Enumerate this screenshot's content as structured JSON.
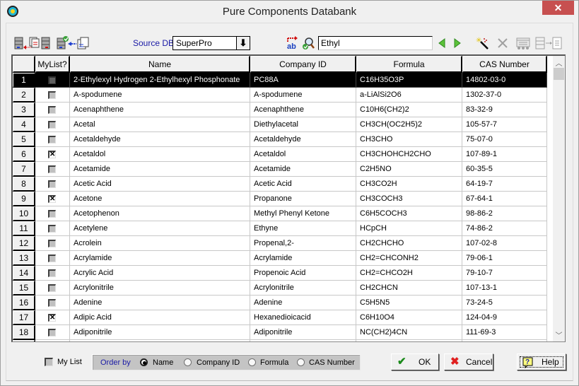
{
  "window": {
    "title": "Pure Components Databank",
    "close_label": "✕"
  },
  "toolbar": {
    "source_db_label": "Source DB",
    "source_db_value": "SuperPro",
    "search_value": "Ethyl",
    "icons": [
      "import-from-db-icon",
      "db-to-db-copy-icon",
      "verify-import-icon",
      "copy-list-icon",
      "find-replace-icon",
      "find-icon",
      "previous-icon",
      "next-icon",
      "new-component-icon",
      "delete-icon",
      "properties-icon",
      "export-icon"
    ]
  },
  "grid": {
    "columns": [
      "",
      "MyList?",
      "Name",
      "Company ID",
      "Formula",
      "CAS Number"
    ],
    "rows": [
      {
        "num": "1",
        "mylist": false,
        "name": "2-Ethylexyl Hydrogen 2-Ethylhexyl Phosphonate",
        "company_id": "PC88A",
        "formula": "C16H35O3P",
        "cas": "14802-03-0",
        "selected": true
      },
      {
        "num": "2",
        "mylist": false,
        "name": "A-spodumene",
        "company_id": "A-spodumene",
        "formula": "a-LiAlSi2O6",
        "cas": "1302-37-0"
      },
      {
        "num": "3",
        "mylist": false,
        "name": "Acenaphthene",
        "company_id": "Acenaphthene",
        "formula": "C10H6(CH2)2",
        "cas": "83-32-9"
      },
      {
        "num": "4",
        "mylist": false,
        "name": "Acetal",
        "company_id": "Diethylacetal",
        "formula": "CH3CH(OC2H5)2",
        "cas": "105-57-7"
      },
      {
        "num": "5",
        "mylist": false,
        "name": "Acetaldehyde",
        "company_id": "Acetaldehyde",
        "formula": "CH3CHO",
        "cas": "75-07-0"
      },
      {
        "num": "6",
        "mylist": true,
        "name": "Acetaldol",
        "company_id": "Acetaldol",
        "formula": "CH3CHOHCH2CHO",
        "cas": "107-89-1"
      },
      {
        "num": "7",
        "mylist": false,
        "name": "Acetamide",
        "company_id": "Acetamide",
        "formula": "C2H5NO",
        "cas": "60-35-5"
      },
      {
        "num": "8",
        "mylist": false,
        "name": "Acetic Acid",
        "company_id": "Acetic Acid",
        "formula": "CH3CO2H",
        "cas": "64-19-7"
      },
      {
        "num": "9",
        "mylist": true,
        "name": "Acetone",
        "company_id": "Propanone",
        "formula": "CH3COCH3",
        "cas": "67-64-1"
      },
      {
        "num": "10",
        "mylist": false,
        "name": "Acetophenon",
        "company_id": "Methyl Phenyl Ketone",
        "formula": "C6H5COCH3",
        "cas": "98-86-2"
      },
      {
        "num": "11",
        "mylist": false,
        "name": "Acetylene",
        "company_id": "Ethyne",
        "formula": "HCpCH",
        "cas": "74-86-2"
      },
      {
        "num": "12",
        "mylist": false,
        "name": "Acrolein",
        "company_id": "Propenal,2-",
        "formula": "CH2CHCHO",
        "cas": "107-02-8"
      },
      {
        "num": "13",
        "mylist": false,
        "name": "Acrylamide",
        "company_id": "Acrylamide",
        "formula": "CH2=CHCONH2",
        "cas": "79-06-1"
      },
      {
        "num": "14",
        "mylist": false,
        "name": "Acrylic Acid",
        "company_id": "Propenoic Acid",
        "formula": "CH2=CHCO2H",
        "cas": "79-10-7"
      },
      {
        "num": "15",
        "mylist": false,
        "name": "Acrylonitrile",
        "company_id": "Acrylonitrile",
        "formula": "CH2CHCN",
        "cas": "107-13-1"
      },
      {
        "num": "16",
        "mylist": false,
        "name": "Adenine",
        "company_id": "Adenine",
        "formula": "C5H5N5",
        "cas": "73-24-5"
      },
      {
        "num": "17",
        "mylist": true,
        "name": "Adipic Acid",
        "company_id": "Hexanedioicacid",
        "formula": "C6H10O4",
        "cas": "124-04-9"
      },
      {
        "num": "18",
        "mylist": false,
        "name": "Adiponitrile",
        "company_id": "Adiponitrile",
        "formula": "NC(CH2)4CN",
        "cas": "111-69-3"
      },
      {
        "num": "",
        "mylist": false,
        "name": "",
        "company_id": "",
        "formula": "",
        "cas": "",
        "partial": true
      }
    ]
  },
  "footer": {
    "mylist_label": "My List",
    "mylist_checked": false,
    "order_by_label": "Order by",
    "order_options": [
      "Name",
      "Company ID",
      "Formula",
      "CAS Number"
    ],
    "order_selected": "Name",
    "ok_label": "OK",
    "cancel_label": "Cancel",
    "help_label": "Help"
  },
  "colors": {
    "accent_text": "#1a1aa6",
    "close_button": "#c75050",
    "selected_row": "#000000"
  }
}
